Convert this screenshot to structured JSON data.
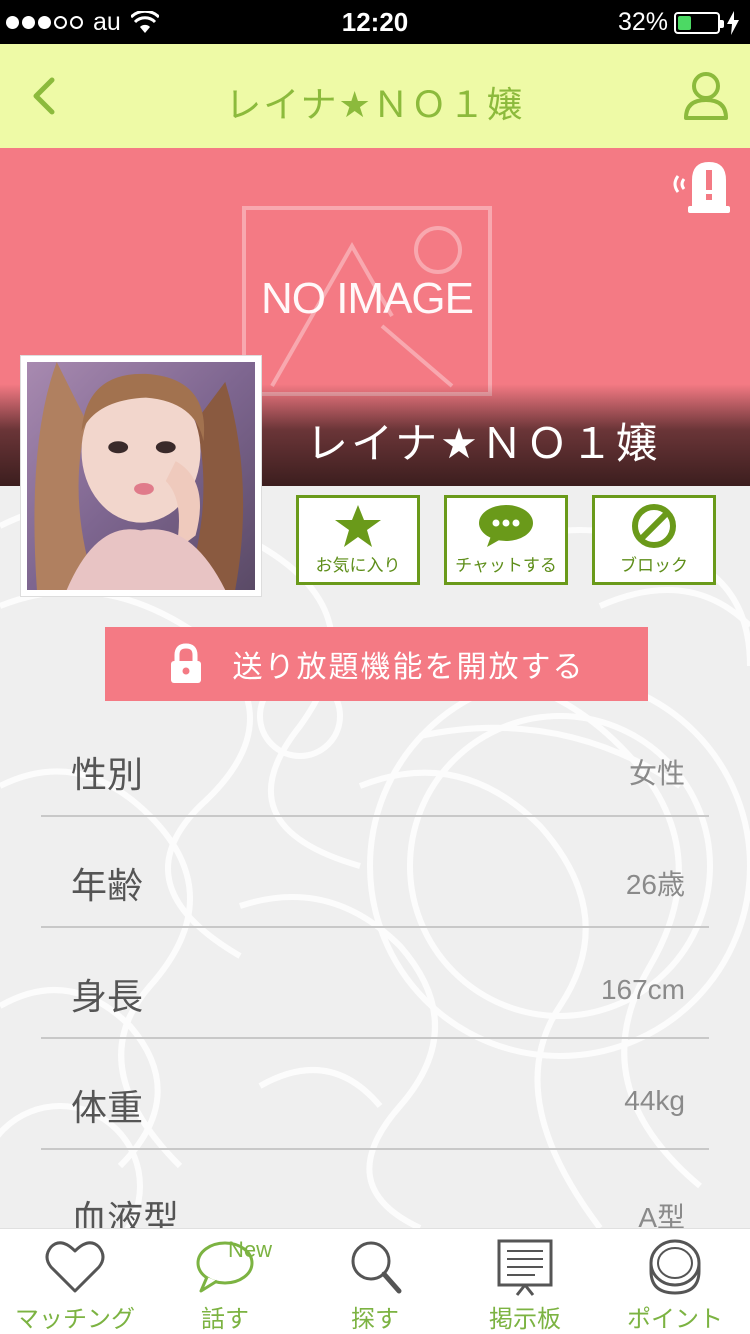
{
  "status_bar": {
    "carrier": "au",
    "time": "12:20",
    "battery_percent": "32%",
    "battery_level": 0.32
  },
  "nav": {
    "title": "レイナ★ＮＯ１嬢",
    "back_icon": "chevron-left-icon",
    "user_icon": "user-icon",
    "color": "#8cba3c",
    "background": "#eefaa6"
  },
  "header": {
    "placeholder_text": "NO IMAGE",
    "name": "レイナ★ＮＯ１嬢",
    "report_icon": "report-alert-icon",
    "background": "#f47a84"
  },
  "actions": {
    "favorite_label": "お気に入り",
    "chat_label": "チャットする",
    "block_label": "ブロック",
    "accent": "#6a9a1a"
  },
  "unlock": {
    "label": "送り放題機能を開放する",
    "icon": "lock-icon"
  },
  "profile_rows": [
    {
      "label": "性別",
      "value": "女性"
    },
    {
      "label": "年齢",
      "value": "26歳"
    },
    {
      "label": "身長",
      "value": "167cm"
    },
    {
      "label": "体重",
      "value": "44kg"
    },
    {
      "label": "血液型",
      "value": "A型"
    }
  ],
  "tabs": [
    {
      "label": "マッチング",
      "icon": "heart-icon"
    },
    {
      "label": "話す",
      "icon": "speech-bubble-icon",
      "badge": "New"
    },
    {
      "label": "探す",
      "icon": "magnifier-icon"
    },
    {
      "label": "掲示板",
      "icon": "bulletin-board-icon"
    },
    {
      "label": "ポイント",
      "icon": "coin-icon"
    }
  ]
}
